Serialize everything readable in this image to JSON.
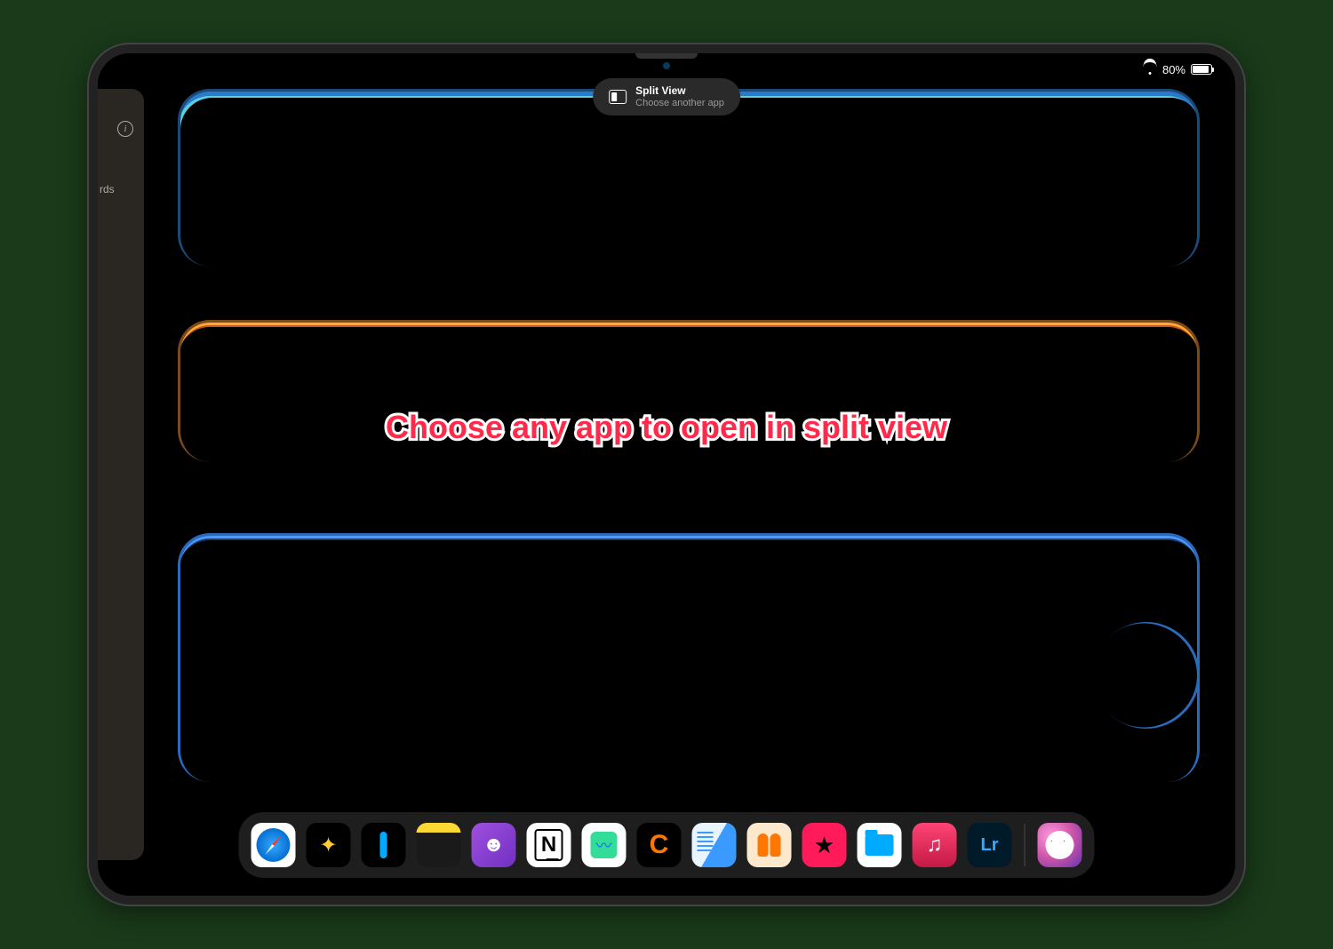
{
  "status_bar": {
    "battery_percent": "80%"
  },
  "split_view": {
    "title": "Split View",
    "subtitle": "Choose another app"
  },
  "stowed_app": {
    "visible_text": "rds"
  },
  "annotation": {
    "text": "Choose any app to open in split view"
  },
  "dock": {
    "items": [
      {
        "name": "safari",
        "label": ""
      },
      {
        "name": "butterfly-app",
        "label": "✦"
      },
      {
        "name": "linear-app",
        "label": ""
      },
      {
        "name": "notes",
        "label": ""
      },
      {
        "name": "craft",
        "label": "☻"
      },
      {
        "name": "notion",
        "label": "N"
      },
      {
        "name": "freeform",
        "label": ""
      },
      {
        "name": "orange-c-app",
        "label": "C"
      },
      {
        "name": "goodnotes",
        "label": ""
      },
      {
        "name": "books",
        "label": ""
      },
      {
        "name": "pink-star-app",
        "label": "★"
      },
      {
        "name": "files",
        "label": ""
      },
      {
        "name": "music",
        "label": "♫"
      },
      {
        "name": "lightroom",
        "label": "Lr"
      }
    ],
    "recent": [
      {
        "name": "recent-app",
        "label": ""
      }
    ]
  }
}
